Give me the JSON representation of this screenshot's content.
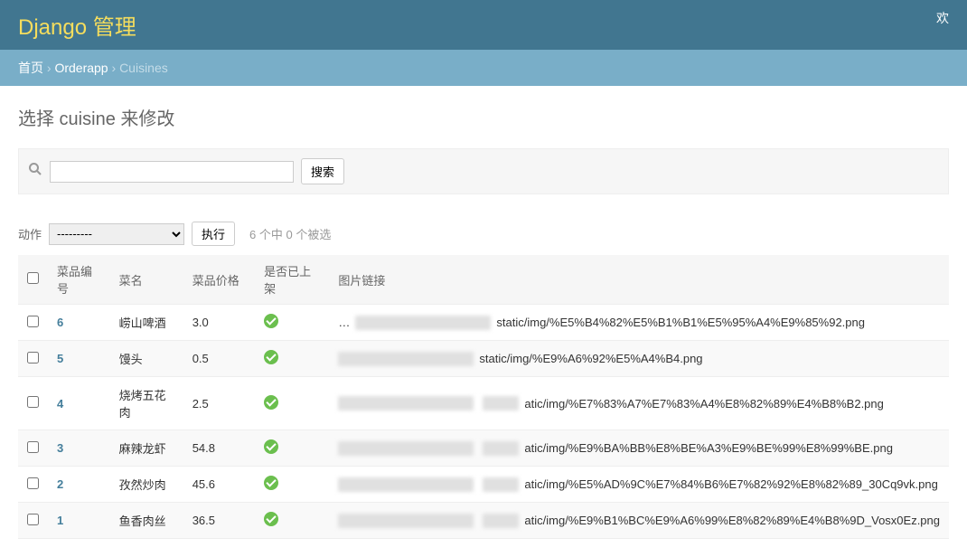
{
  "header": {
    "brand": "Django 管理",
    "welcome": "欢"
  },
  "breadcrumbs": {
    "home": "首页",
    "app": "Orderapp",
    "model": "Cuisines",
    "sep": " › "
  },
  "page_title": "选择 cuisine 来修改",
  "search": {
    "button": "搜索"
  },
  "actions": {
    "label": "动作",
    "placeholder": "---------",
    "go": "执行",
    "selection": "6 个中 0 个被选"
  },
  "columns": {
    "chk": "",
    "id": "菜品编号",
    "name": "菜名",
    "price": "菜品价格",
    "shelf": "是否已上架",
    "img": "图片链接"
  },
  "rows": [
    {
      "id": "6",
      "name": "崂山啤酒",
      "price": "3.0",
      "path": "static/img/%E5%B4%82%E5%B1%B1%E5%95%A4%E9%85%92.png",
      "prefix": "…"
    },
    {
      "id": "5",
      "name": "馒头",
      "price": "0.5",
      "path": "static/img/%E9%A6%92%E5%A4%B4.png",
      "prefix": ""
    },
    {
      "id": "4",
      "name": "烧烤五花肉",
      "price": "2.5",
      "path": "atic/img/%E7%83%A7%E7%83%A4%E8%82%89%E4%B8%B2.png",
      "prefix": ""
    },
    {
      "id": "3",
      "name": "麻辣龙虾",
      "price": "54.8",
      "path": "atic/img/%E9%BA%BB%E8%BE%A3%E9%BE%99%E8%99%BE.png",
      "prefix": ""
    },
    {
      "id": "2",
      "name": "孜然炒肉",
      "price": "45.6",
      "path": "atic/img/%E5%AD%9C%E7%84%B6%E7%82%92%E8%82%89_30Cq9vk.png",
      "prefix": ""
    },
    {
      "id": "1",
      "name": "鱼香肉丝",
      "price": "36.5",
      "path": "atic/img/%E9%B1%BC%E9%A6%99%E8%82%89%E4%B8%9D_Vosx0Ez.png",
      "prefix": ""
    }
  ]
}
